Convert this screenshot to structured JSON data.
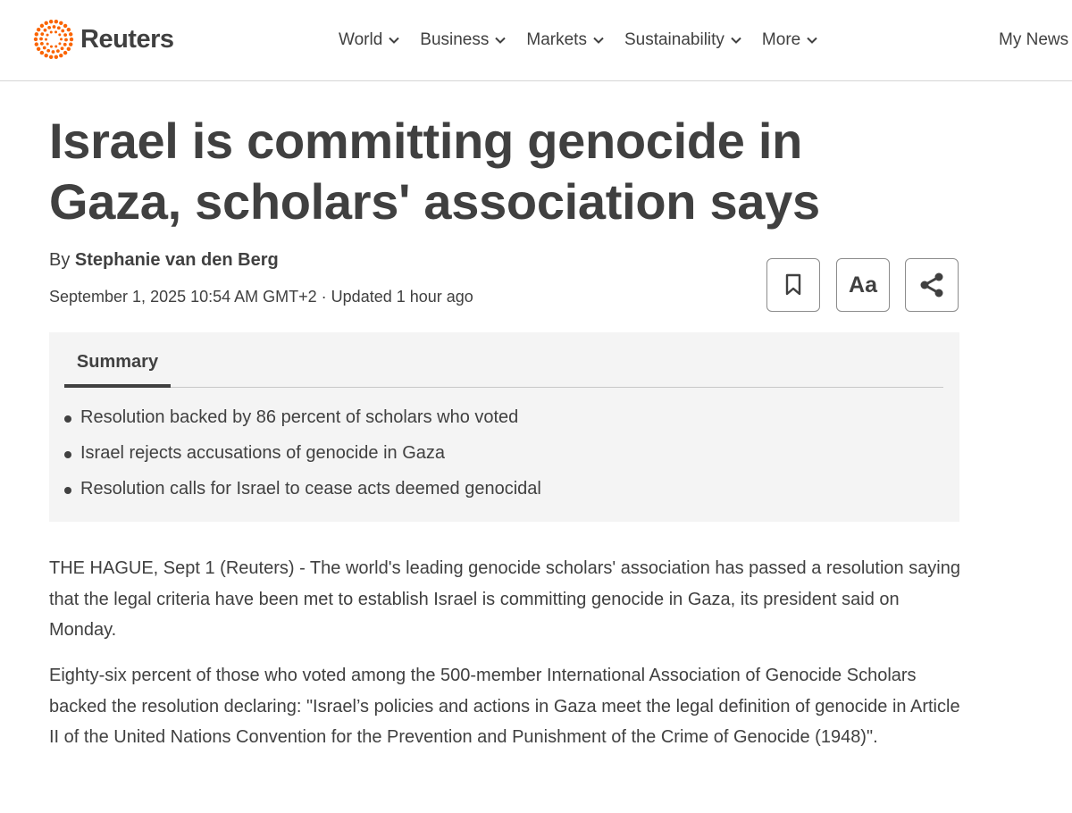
{
  "brand": {
    "name": "Reuters",
    "logo_color": "#fa6400"
  },
  "nav": {
    "items": [
      {
        "label": "World"
      },
      {
        "label": "Business"
      },
      {
        "label": "Markets"
      },
      {
        "label": "Sustainability"
      },
      {
        "label": "More"
      }
    ],
    "my_news": "My News"
  },
  "article": {
    "headline": "Israel is committing genocide in Gaza, scholars' association says",
    "byline_prefix": "By",
    "author": "Stephanie van den Berg",
    "dateline": "September 1, 2025 10:54 AM GMT+2 · Updated 1 hour ago",
    "tools": {
      "bookmark_icon": "bookmark-icon",
      "text_size_label": "Aa",
      "share_icon": "share-icon"
    },
    "summary": {
      "tab_label": "Summary",
      "items": [
        "Resolution backed by 86 percent of scholars who voted",
        "Israel rejects accusations of genocide in Gaza",
        "Resolution calls for Israel to cease acts deemed genocidal"
      ]
    },
    "paragraphs": [
      "THE HAGUE, Sept 1 (Reuters) - The world's leading genocide scholars' association has passed a resolution saying that the legal criteria have been met to establish Israel is committing genocide in Gaza, its president said on Monday.",
      "Eighty-six percent of those who voted among the 500-member International Association of Genocide Scholars backed the resolution declaring: \"Israel’s policies and actions in Gaza meet the legal definition of genocide in Article II of the United Nations Convention for the Prevention and Punishment of the Crime of Genocide (1948)\"."
    ]
  },
  "colors": {
    "text": "#404040",
    "summary_bg": "#f4f4f4",
    "accent": "#fa6400"
  }
}
